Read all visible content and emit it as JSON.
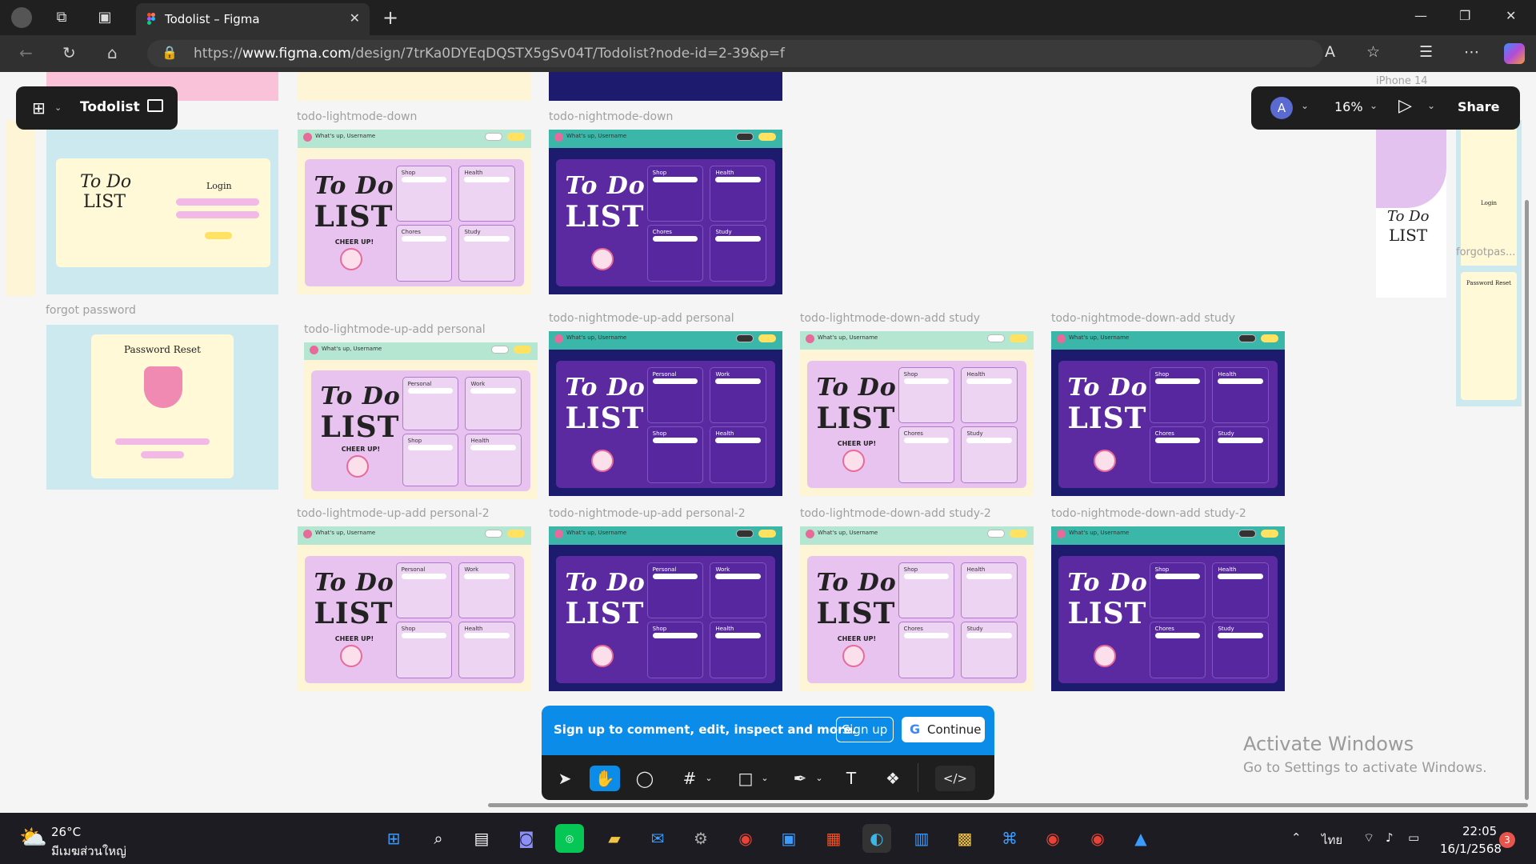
{
  "browser": {
    "tab_title": "Todolist – Figma",
    "url_prefix": "https://",
    "url_domain": "www.figma.com",
    "url_path": "/design/7trKa0DYEqDQSTX5gSv04T/Todolist?node-id=2-39&p=f"
  },
  "figma": {
    "file_name": "Todolist",
    "avatar_letter": "A",
    "zoom": "16%",
    "share_label": "Share",
    "signup_message": "Sign up to comment, edit, inspect and more.",
    "signup_button": "Sign up",
    "continue_button": "Continue"
  },
  "frames": {
    "iphone_label": "iPhone 14",
    "forgot_password_label": "forgot password",
    "forgotpas_label": "forgotpas...",
    "todo_lightmode_down": "todo-lightmode-down",
    "todo_nightmode_down": "todo-nightmode-down",
    "todo_lightmode_up_add_personal": "todo-lightmode-up-add personal",
    "todo_nightmode_up_add_personal": "todo-nightmode-up-add personal",
    "todo_lightmode_down_add_study": "todo-lightmode-down-add study",
    "todo_nightmode_down_add_study": "todo-nightmode-down-add study",
    "todo_lightmode_up_add_personal_2": "todo-lightmode-up-add personal-2",
    "todo_nightmode_up_add_personal_2": "todo-nightmode-up-add personal-2",
    "todo_lightmode_down_add_study_2": "todo-lightmode-down-add study-2",
    "todo_nightmode_down_add_study_2": "todo-nightmode-down-add study-2"
  },
  "frame_content": {
    "greeting": "What's up, Username",
    "title_to_do": "To Do",
    "title_list": "LIST",
    "cheer": "CHEER UP!",
    "login_title": "Login",
    "password_reset_title": "Password Reset",
    "cards_a": [
      "Shop",
      "Health",
      "Chores",
      "Study"
    ],
    "cards_b": [
      "Personal",
      "Work",
      "Shop",
      "Health"
    ]
  },
  "watermark": {
    "title": "Activate Windows",
    "subtitle": "Go to Settings to activate Windows."
  },
  "taskbar": {
    "temperature": "26°C",
    "location": "มีเมฆส่วนใหญ่",
    "language": "ไทย",
    "time": "22:05",
    "date": "16/1/2568",
    "notification_count": "3"
  }
}
